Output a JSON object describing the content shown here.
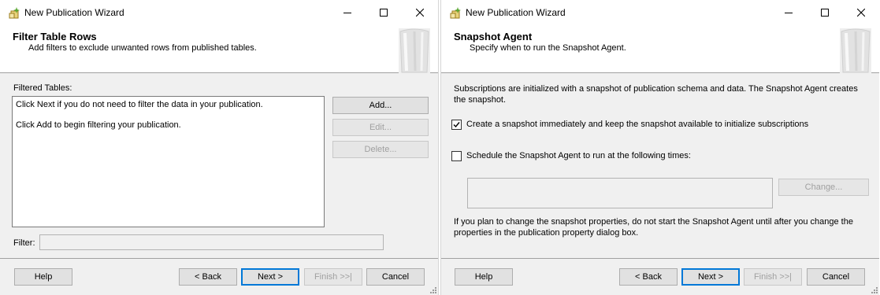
{
  "wizard1": {
    "window_title": "New Publication Wizard",
    "header_title": "Filter Table Rows",
    "header_subtitle": "Add filters to exclude unwanted rows from published tables.",
    "filtered_tables_label": "Filtered Tables:",
    "list_lines": [
      "Click Next if you do not need to filter the data in your publication.",
      "Click Add to begin filtering your publication."
    ],
    "add_button": "Add...",
    "edit_button": "Edit...",
    "delete_button": "Delete...",
    "filter_label": "Filter:",
    "filter_value": "",
    "help_button": "Help",
    "back_button": "< Back",
    "next_button": "Next >",
    "finish_button": "Finish >>|",
    "cancel_button": "Cancel"
  },
  "wizard2": {
    "window_title": "New Publication Wizard",
    "header_title": "Snapshot Agent",
    "header_subtitle": "Specify when to run the Snapshot Agent.",
    "intro_text": "Subscriptions are initialized with a snapshot of publication schema and data. The Snapshot Agent creates the snapshot.",
    "create_snapshot_label": "Create a snapshot immediately and keep the snapshot available to initialize subscriptions",
    "create_snapshot_checked": true,
    "schedule_label": "Schedule the Snapshot Agent to run at the following times:",
    "schedule_checked": false,
    "schedule_value": "",
    "change_button": "Change...",
    "note_text": "If you plan to change the snapshot properties, do not start the Snapshot Agent until after you change the properties in the publication property dialog box.",
    "help_button": "Help",
    "back_button": "< Back",
    "next_button": "Next >",
    "finish_button": "Finish >>|",
    "cancel_button": "Cancel"
  },
  "icons": {
    "app": "wizard-app-icon",
    "minimize": "minimize-icon",
    "maximize": "maximize-icon",
    "close": "close-icon",
    "checkmark": "checkmark-icon",
    "header_art": "wizard-header-art",
    "resize_grip": "resize-grip-icon"
  },
  "colors": {
    "dialog_background": "#f0f0f0",
    "header_background": "#ffffff",
    "default_button_border": "#0078d7",
    "disabled_text": "#a0a0a0"
  }
}
